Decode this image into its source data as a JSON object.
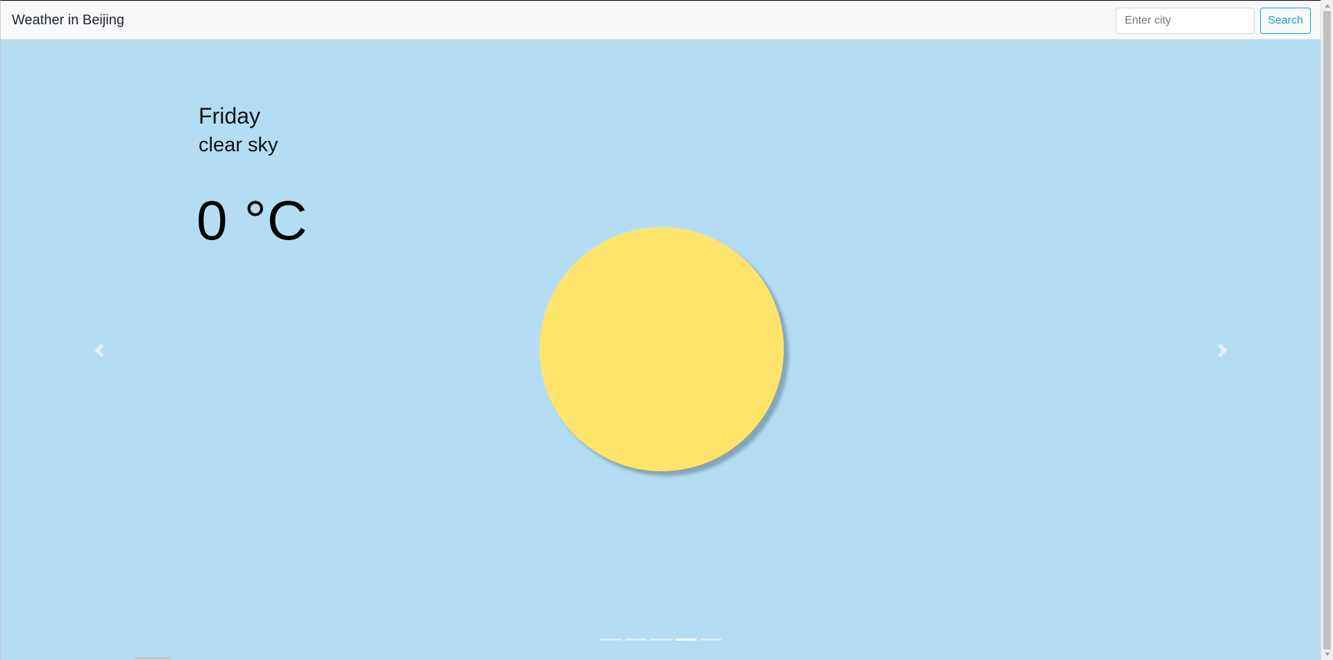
{
  "navbar": {
    "title": "Weather in Beijing",
    "search_placeholder": "Enter city",
    "search_value": "",
    "search_button": "Search"
  },
  "forecast": {
    "day": "Friday",
    "description": "clear sky",
    "temperature": "0 °C",
    "icon": "sun-icon"
  },
  "carousel": {
    "indicator_count": 5,
    "active_index": 3
  },
  "colors": {
    "sky_background": "#b4ddf4",
    "sun": "#ffe46c",
    "accent": "#17a2b8"
  }
}
